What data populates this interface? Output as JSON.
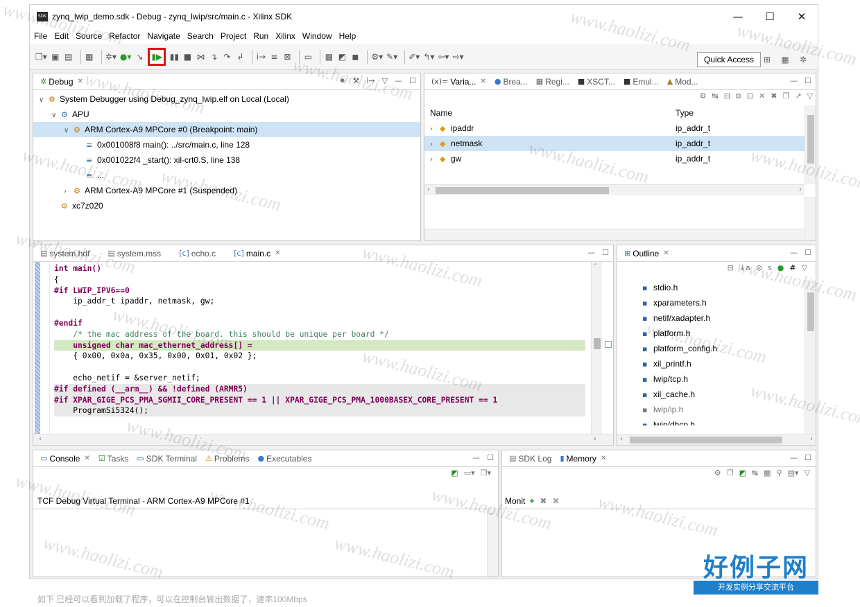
{
  "window": {
    "title": "zynq_lwip_demo.sdk - Debug - zynq_lwip/src/main.c - Xilinx SDK",
    "app_icon": "SDK",
    "controls": [
      "—",
      "☐",
      "✕"
    ]
  },
  "menu": [
    "File",
    "Edit",
    "Source",
    "Refactor",
    "Navigate",
    "Search",
    "Project",
    "Run",
    "Xilinx",
    "Window",
    "Help"
  ],
  "toolbar": {
    "quick_access": "Quick Access",
    "highlighted_button": "resume-icon"
  },
  "debug_view": {
    "tab_label": "Debug",
    "tree": [
      {
        "text": "System Debugger using Debug_zynq_lwip.elf on Local (Local)",
        "level": 0,
        "icon": "launch-icon",
        "twisty": "open"
      },
      {
        "text": "APU",
        "level": 1,
        "icon": "cpu-group-icon",
        "twisty": "open"
      },
      {
        "text": "ARM Cortex-A9 MPCore #0 (Breakpoint: main)",
        "level": 2,
        "icon": "thread-icon",
        "twisty": "open",
        "selected": true
      },
      {
        "text": "0x001008f8 main(): ../src/main.c, line 128",
        "level": 3,
        "icon": "stack-frame-icon",
        "twisty": ""
      },
      {
        "text": "0x001022f4 _start(): xil-crt0.S, line 138",
        "level": 3,
        "icon": "stack-frame-icon",
        "twisty": ""
      },
      {
        "text": "...",
        "level": 3,
        "icon": "stack-frame-icon",
        "twisty": ""
      },
      {
        "text": "ARM Cortex-A9 MPCore #1 (Suspended)",
        "level": 2,
        "icon": "thread-icon",
        "twisty": "closed"
      },
      {
        "text": "xc7z020",
        "level": 1,
        "icon": "target-icon",
        "twisty": ""
      }
    ]
  },
  "variables_view": {
    "tabs": [
      "Varia...",
      "Brea...",
      "Regi...",
      "XSCT...",
      "Emul...",
      "Mod..."
    ],
    "columns": [
      "Name",
      "Type"
    ],
    "rows": [
      {
        "name": "ipaddr",
        "type": "ip_addr_t"
      },
      {
        "name": "netmask",
        "type": "ip_addr_t"
      },
      {
        "name": "gw",
        "type": "ip_addr_t"
      }
    ]
  },
  "editor": {
    "tabs": [
      "system.hdf",
      "system.mss",
      "echo.c",
      "main.c"
    ],
    "active_tab": "main.c",
    "lines": [
      "int main()",
      "{",
      "#if LWIP_IPV6==0",
      "    ip_addr_t ipaddr, netmask, gw;",
      "",
      "#endif",
      "    /* the mac address of the board. this should be unique per board */",
      "    unsigned char mac_ethernet_address[] =",
      "    { 0x00, 0x0a, 0x35, 0x00, 0x01, 0x02 };",
      "",
      "    echo_netif = &server_netif;",
      "#if defined (__arm__) && !defined (ARMR5)",
      "#if XPAR_GIGE_PCS_PMA_SGMII_CORE_PRESENT == 1 || XPAR_GIGE_PCS_PMA_1000BASEX_CORE_PRESENT == 1",
      "    ProgramSi5324();"
    ]
  },
  "outline_view": {
    "tab_label": "Outline",
    "items": [
      "stdio.h",
      "xparameters.h",
      "netif/xadapter.h",
      "platform.h",
      "platform_config.h",
      "xil_printf.h",
      "lwip/tcp.h",
      "xil_cache.h",
      "lwip/ip.h",
      "lwip/dhcp.h"
    ]
  },
  "console_view": {
    "tabs": [
      "Console",
      "Tasks",
      "SDK Terminal",
      "Problems",
      "Executables"
    ],
    "header": "TCF Debug Virtual Terminal - ARM Cortex-A9 MPCore #1"
  },
  "memory_view": {
    "tabs": [
      "SDK Log",
      "Memory"
    ],
    "monitors_label": "Monit"
  },
  "watermark": {
    "text": "www.haolizi.com",
    "logo_main": "好例子网",
    "logo_sub": "开发实例分享交流平台"
  },
  "bottom_text": "如下 已经可以看到加载了程序，可以在控制台输出数据了，速率100Mbps"
}
